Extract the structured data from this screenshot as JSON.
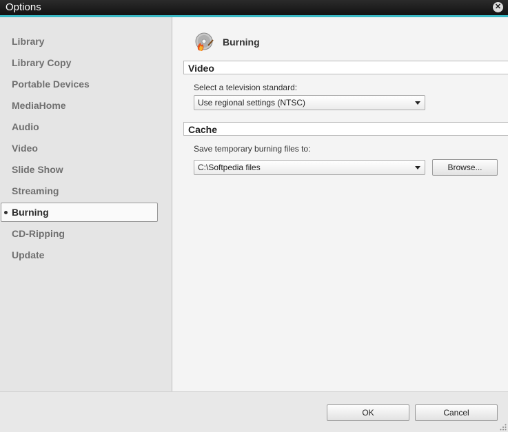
{
  "window": {
    "title": "Options"
  },
  "sidebar": {
    "items": [
      {
        "label": "Library"
      },
      {
        "label": "Library Copy"
      },
      {
        "label": "Portable Devices"
      },
      {
        "label": "MediaHome"
      },
      {
        "label": "Audio"
      },
      {
        "label": "Video"
      },
      {
        "label": "Slide Show"
      },
      {
        "label": "Streaming"
      },
      {
        "label": "Burning"
      },
      {
        "label": "CD-Ripping"
      },
      {
        "label": "Update"
      }
    ],
    "selected": "Burning"
  },
  "page": {
    "title": "Burning",
    "icon": "burning-disc-icon",
    "video_section": {
      "header": "Video",
      "tv_standard_label": "Select a television standard:",
      "tv_standard_value": "Use regional settings (NTSC)"
    },
    "cache_section": {
      "header": "Cache",
      "save_label": "Save temporary burning files to:",
      "path_value": "C:\\Softpedia files",
      "browse_label": "Browse..."
    }
  },
  "footer": {
    "ok_label": "OK",
    "cancel_label": "Cancel"
  },
  "colors": {
    "accent": "#39b8c4",
    "titlebar": "#1a1a1a"
  }
}
